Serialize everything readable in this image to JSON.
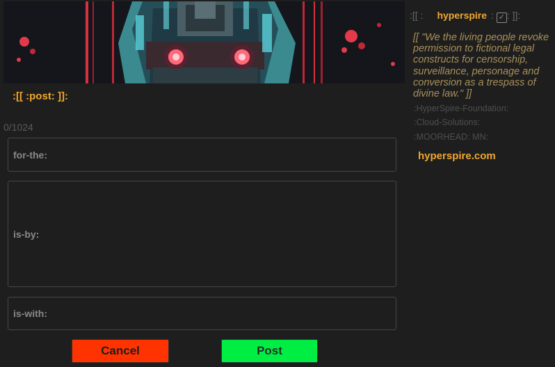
{
  "post_heading": ":[[ :post: ]]:",
  "char_counter": "0/1024",
  "fields": {
    "for_label": "for-the:",
    "by_label": "is-by:",
    "with_label": "is-with:"
  },
  "buttons": {
    "cancel": "Cancel",
    "post": "Post"
  },
  "sidebar": {
    "prefix": ":[[ :",
    "username": "hyperspire",
    "verified_prefix": ":",
    "verified_symbol": "✓",
    "suffix": ": ]]:",
    "quote": "[[ \"We the living people revoke permission to fictional legal constructs for censorship, surveillance, personage and conversion as a trespass of divine law.\" ]]",
    "meta_1": ":HyperSpire-Foundation:",
    "meta_2": ":Cloud-Solutions:",
    "meta_3": ":MOORHEAD: MN:",
    "link": "hyperspire.com"
  },
  "colors": {
    "background": "#1e1e1e",
    "accent": "#f0a830",
    "cancel": "#ff3300",
    "post": "#00ee44",
    "quote": "#a8905a"
  },
  "banner": {
    "icon": "cyberpunk-skull-banner"
  }
}
